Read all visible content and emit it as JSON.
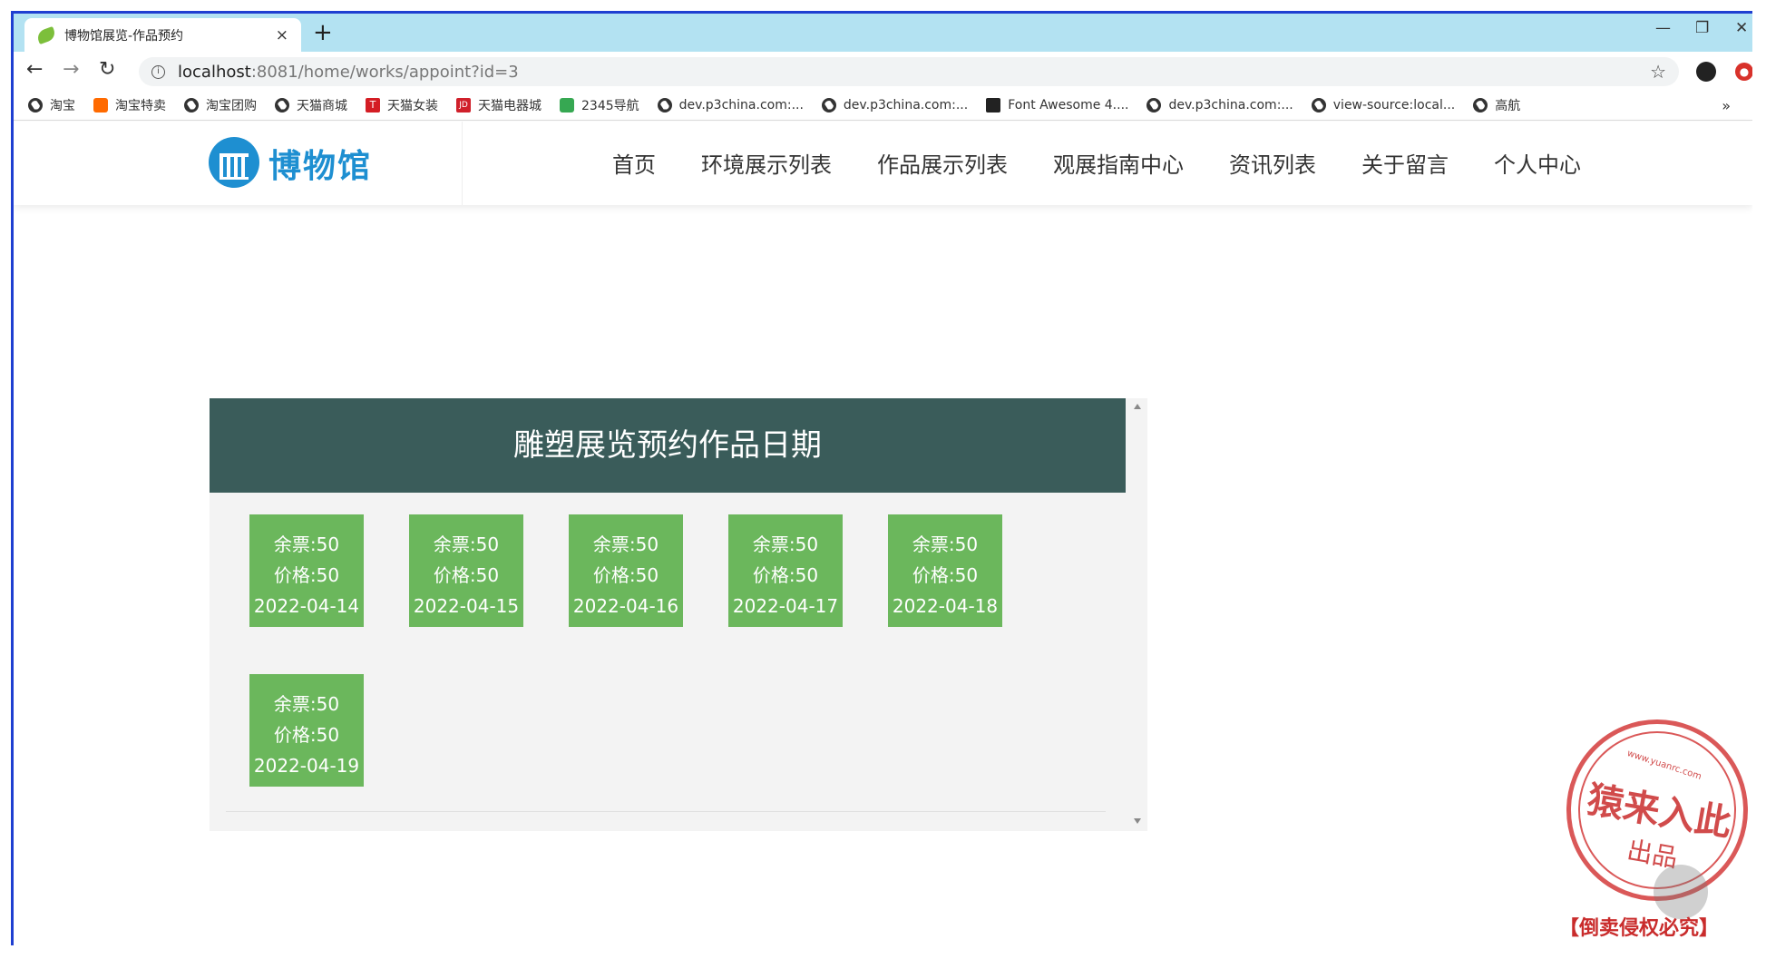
{
  "browser": {
    "tab_title": "博物馆展览-作品预约",
    "tab_close": "×",
    "new_tab": "+",
    "window_controls": {
      "minimize": "—",
      "restore": "❐",
      "close": "✕"
    },
    "url_host": "localhost",
    "url_path": ":8081/home/works/appoint?id=3",
    "bookmarks": [
      {
        "label": "淘宝",
        "icon": "globe-icon"
      },
      {
        "label": "淘宝特卖",
        "icon": "taobao-icon"
      },
      {
        "label": "淘宝团购",
        "icon": "globe-icon"
      },
      {
        "label": "天猫商城",
        "icon": "globe-icon"
      },
      {
        "label": "天猫女装",
        "icon": "tmall-icon"
      },
      {
        "label": "天猫电器城",
        "icon": "jd-icon"
      },
      {
        "label": "2345导航",
        "icon": "nav-icon"
      },
      {
        "label": "dev.p3china.com:...",
        "icon": "globe-icon"
      },
      {
        "label": "dev.p3china.com:...",
        "icon": "globe-icon"
      },
      {
        "label": "Font Awesome 4....",
        "icon": "fontawesome-icon"
      },
      {
        "label": "dev.p3china.com:...",
        "icon": "globe-icon"
      },
      {
        "label": "view-source:local...",
        "icon": "globe-icon"
      },
      {
        "label": "高航",
        "icon": "globe-icon"
      }
    ],
    "bookmarks_more": "»"
  },
  "site": {
    "logo_text": "博物馆",
    "menu": [
      "首页",
      "环境展示列表",
      "作品展示列表",
      "观展指南中心",
      "资讯列表",
      "关于留言",
      "个人中心"
    ]
  },
  "booking": {
    "title": "雕塑展览预约作品日期",
    "slots": [
      {
        "tickets": "余票:50",
        "price": "价格:50",
        "date": "2022-04-14"
      },
      {
        "tickets": "余票:50",
        "price": "价格:50",
        "date": "2022-04-15"
      },
      {
        "tickets": "余票:50",
        "price": "价格:50",
        "date": "2022-04-16"
      },
      {
        "tickets": "余票:50",
        "price": "价格:50",
        "date": "2022-04-17"
      },
      {
        "tickets": "余票:50",
        "price": "价格:50",
        "date": "2022-04-18"
      },
      {
        "tickets": "余票:50",
        "price": "价格:50",
        "date": "2022-04-19"
      }
    ]
  },
  "watermark": {
    "url": "www.yuanrc.com",
    "main": "猿来入此",
    "sub": "出品",
    "note": "【倒卖侵权必究】"
  },
  "colors": {
    "header_bar": "#3a5c5a",
    "slot_green": "#6bb75c",
    "brand_blue": "#1e8fd1",
    "tabstrip": "#b3e2f2"
  }
}
